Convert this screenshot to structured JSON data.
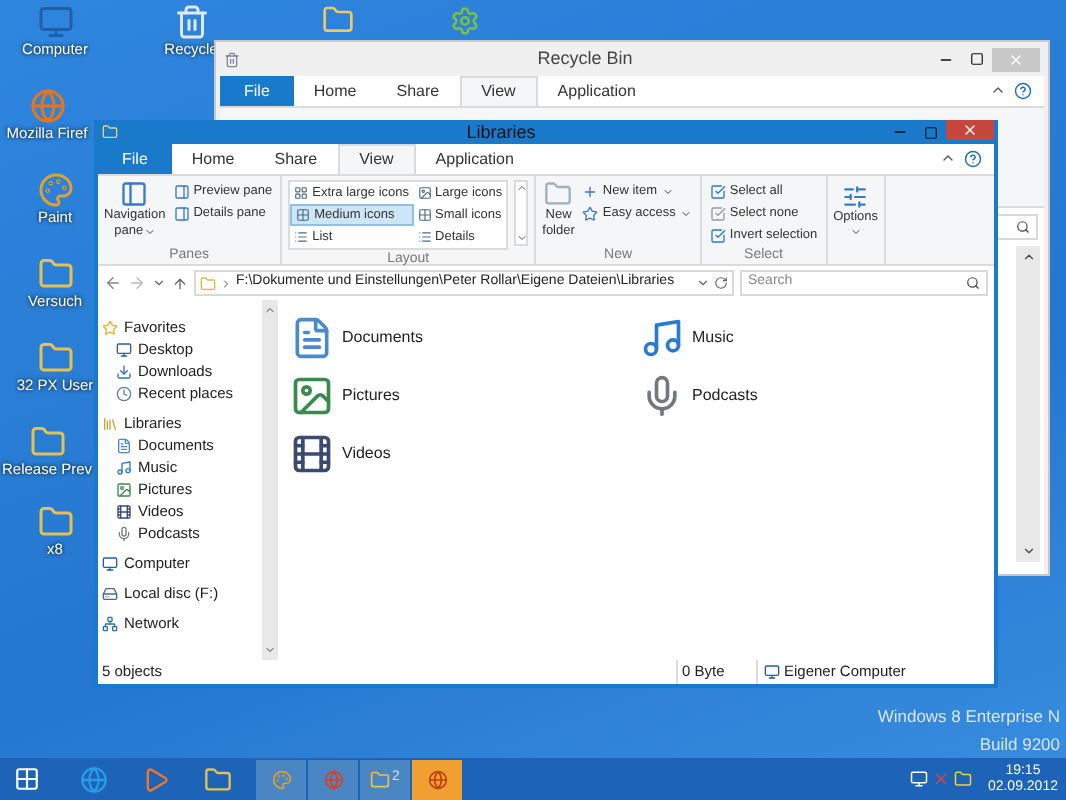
{
  "desktop_icons": [
    {
      "label": "Computer",
      "kind": "computer"
    },
    {
      "label": "Recycle",
      "kind": "recycle"
    },
    {
      "label": "Mozilla Firef",
      "kind": "browser"
    },
    {
      "label": "Paint",
      "kind": "paint"
    },
    {
      "label": "Versuch",
      "kind": "folder"
    },
    {
      "label": "32 PX User",
      "kind": "folder"
    },
    {
      "label": "Release Prev",
      "kind": "folder"
    },
    {
      "label": "x8",
      "kind": "folder"
    }
  ],
  "back_window": {
    "title": "Recycle Bin",
    "file_tab": "File",
    "tabs": [
      {
        "label": "Home",
        "selected": false
      },
      {
        "label": "Share",
        "selected": false
      },
      {
        "label": "View",
        "selected": true
      },
      {
        "label": "Application",
        "selected": false
      }
    ]
  },
  "window": {
    "title": "Libraries",
    "file_tab": "File",
    "tabs": [
      {
        "label": "Home",
        "selected": false
      },
      {
        "label": "Share",
        "selected": false
      },
      {
        "label": "View",
        "selected": true
      },
      {
        "label": "Application",
        "selected": false
      }
    ],
    "ribbon": {
      "panes": {
        "label": "Panes",
        "navigation_pane": [
          "Navigation",
          "pane"
        ],
        "items": [
          "Preview pane",
          "Details pane"
        ]
      },
      "layout": {
        "label": "Layout",
        "items": [
          {
            "label": "Extra large icons",
            "selected": false
          },
          {
            "label": "Large icons",
            "selected": false
          },
          {
            "label": "Medium icons",
            "selected": true
          },
          {
            "label": "Small icons",
            "selected": false
          },
          {
            "label": "List",
            "selected": false
          },
          {
            "label": "Details",
            "selected": false
          }
        ]
      },
      "new": {
        "label": "New",
        "new_folder": [
          "New",
          "folder"
        ],
        "items": [
          "New item",
          "Easy access"
        ]
      },
      "select": {
        "label": "Select",
        "items": [
          "Select all",
          "Select none",
          "Invert selection"
        ]
      },
      "options": {
        "label": "Options"
      }
    },
    "address": {
      "path": "F:\\Dokumente und Einstellungen\\Peter Rollar\\Eigene Dateien\\Libraries",
      "search_placeholder": "Search"
    },
    "nav": [
      {
        "label": "Favorites",
        "kind": "star",
        "children": [
          {
            "label": "Desktop",
            "kind": "desktop"
          },
          {
            "label": "Downloads",
            "kind": "downloads"
          },
          {
            "label": "Recent places",
            "kind": "recent"
          }
        ]
      },
      {
        "label": "Libraries",
        "kind": "library",
        "children": [
          {
            "label": "Documents",
            "kind": "documents"
          },
          {
            "label": "Music",
            "kind": "music"
          },
          {
            "label": "Pictures",
            "kind": "pictures"
          },
          {
            "label": "Videos",
            "kind": "videos"
          },
          {
            "label": "Podcasts",
            "kind": "podcasts"
          }
        ]
      },
      {
        "label": "Computer",
        "kind": "computer"
      },
      {
        "label": "Local disc (F:)",
        "kind": "drive"
      },
      {
        "label": "Network",
        "kind": "network"
      }
    ],
    "items": [
      {
        "label": "Documents",
        "kind": "documents"
      },
      {
        "label": "Pictures",
        "kind": "pictures"
      },
      {
        "label": "Videos",
        "kind": "videos"
      },
      {
        "label": "Music",
        "kind": "music"
      },
      {
        "label": "Podcasts",
        "kind": "podcasts"
      }
    ],
    "status": {
      "count": "5 objects",
      "size": "0 Byte",
      "location": "Eigener Computer"
    }
  },
  "os_info": [
    "Windows 8 Enterprise N",
    "Build 9200"
  ],
  "taskbar": {
    "pinned": [
      {
        "kind": "ie"
      },
      {
        "kind": "media"
      },
      {
        "kind": "explorer"
      }
    ],
    "buttons": [
      {
        "kind": "paint",
        "active": false
      },
      {
        "kind": "browser",
        "active": false
      },
      {
        "kind": "folder",
        "active": false,
        "count": "2"
      },
      {
        "kind": "firefox",
        "active": true
      }
    ],
    "time": "19:15",
    "date": "02.09.2012"
  }
}
